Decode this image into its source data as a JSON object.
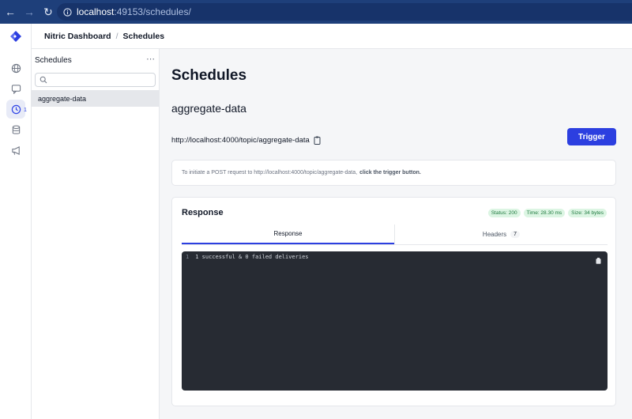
{
  "browser": {
    "url_host": "localhost",
    "url_path": ":49153/schedules/"
  },
  "header": {
    "app_name": "Nitric Dashboard",
    "section": "Schedules"
  },
  "rail": {
    "items": [
      "globe-icon",
      "chat-icon",
      "clock-icon",
      "database-icon",
      "megaphone-icon"
    ],
    "active_badge": "1"
  },
  "schedules_panel": {
    "title": "Schedules",
    "search_placeholder": "",
    "items": [
      {
        "label": "aggregate-data",
        "selected": true
      }
    ]
  },
  "main": {
    "title": "Schedules",
    "schedule_name": "aggregate-data",
    "endpoint": "http://localhost:4000/topic/aggregate-data",
    "trigger_label": "Trigger",
    "info_text": "To initiate a POST request to http://localhost:4000/topic/aggregate-data,",
    "info_bold": "click the trigger button."
  },
  "response": {
    "title": "Response",
    "status_badge": "Status: 200",
    "time_badge": "Time: 28.30 ms",
    "size_badge": "Size: 34 bytes",
    "tabs": [
      {
        "label": "Response",
        "active": true
      },
      {
        "label": "Headers",
        "count": "7",
        "active": false
      }
    ],
    "body_lines": [
      {
        "num": "1",
        "text": "1 successful & 0 failed deliveries"
      }
    ]
  },
  "colors": {
    "primary": "#2c3fe0",
    "chrome": "#1e3f7a",
    "badge_bg": "#dcf5e3",
    "badge_text": "#1f7a3f",
    "code_bg": "#272b33"
  }
}
